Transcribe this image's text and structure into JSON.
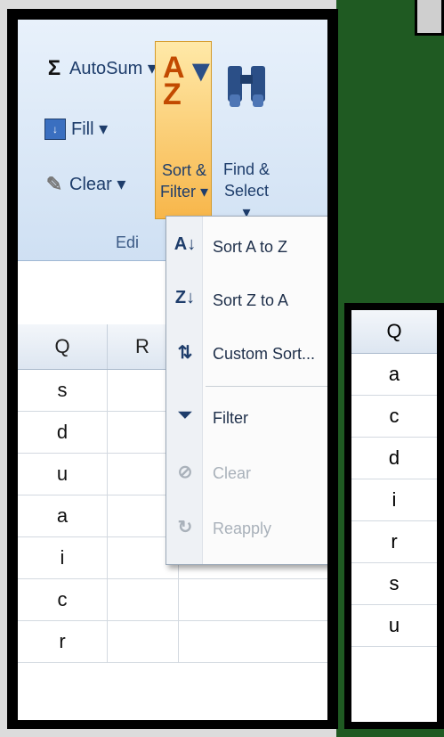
{
  "ribbon": {
    "autosum_label": "AutoSum ▾",
    "fill_label": "Fill ▾",
    "clear_label": "Clear ▾",
    "sort_label_line1": "Sort &",
    "sort_label_line2": "Filter ▾",
    "find_label_line1": "Find &",
    "find_label_line2": "Select ▾",
    "group_label": "Edi"
  },
  "sheet": {
    "columns": [
      "Q",
      "R"
    ],
    "rows": [
      "s",
      "d",
      "u",
      "a",
      "i",
      "c",
      "r"
    ]
  },
  "menu": {
    "items": [
      {
        "label": "Sort A to Z",
        "icon": "sort-a-z-icon",
        "glyph": "A↓"
      },
      {
        "label": "Sort Z to A",
        "icon": "sort-z-a-icon",
        "glyph": "Z↓"
      },
      {
        "label": "Custom Sort...",
        "icon": "custom-sort-icon",
        "glyph": "⇅"
      },
      {
        "label": "Filter",
        "icon": "filter-icon",
        "glyph": "⏷"
      },
      {
        "label": "Clear",
        "icon": "clear-filter-icon",
        "glyph": "⊘"
      },
      {
        "label": "Reapply",
        "icon": "reapply-icon",
        "glyph": "↻"
      }
    ]
  },
  "sorted": {
    "header": "Q",
    "values": [
      "a",
      "c",
      "d",
      "i",
      "r",
      "s",
      "u"
    ]
  },
  "colors": {
    "accent": "#f7b64a",
    "ribbon_text": "#1e3d6b",
    "green_background": "#1f5a22"
  }
}
